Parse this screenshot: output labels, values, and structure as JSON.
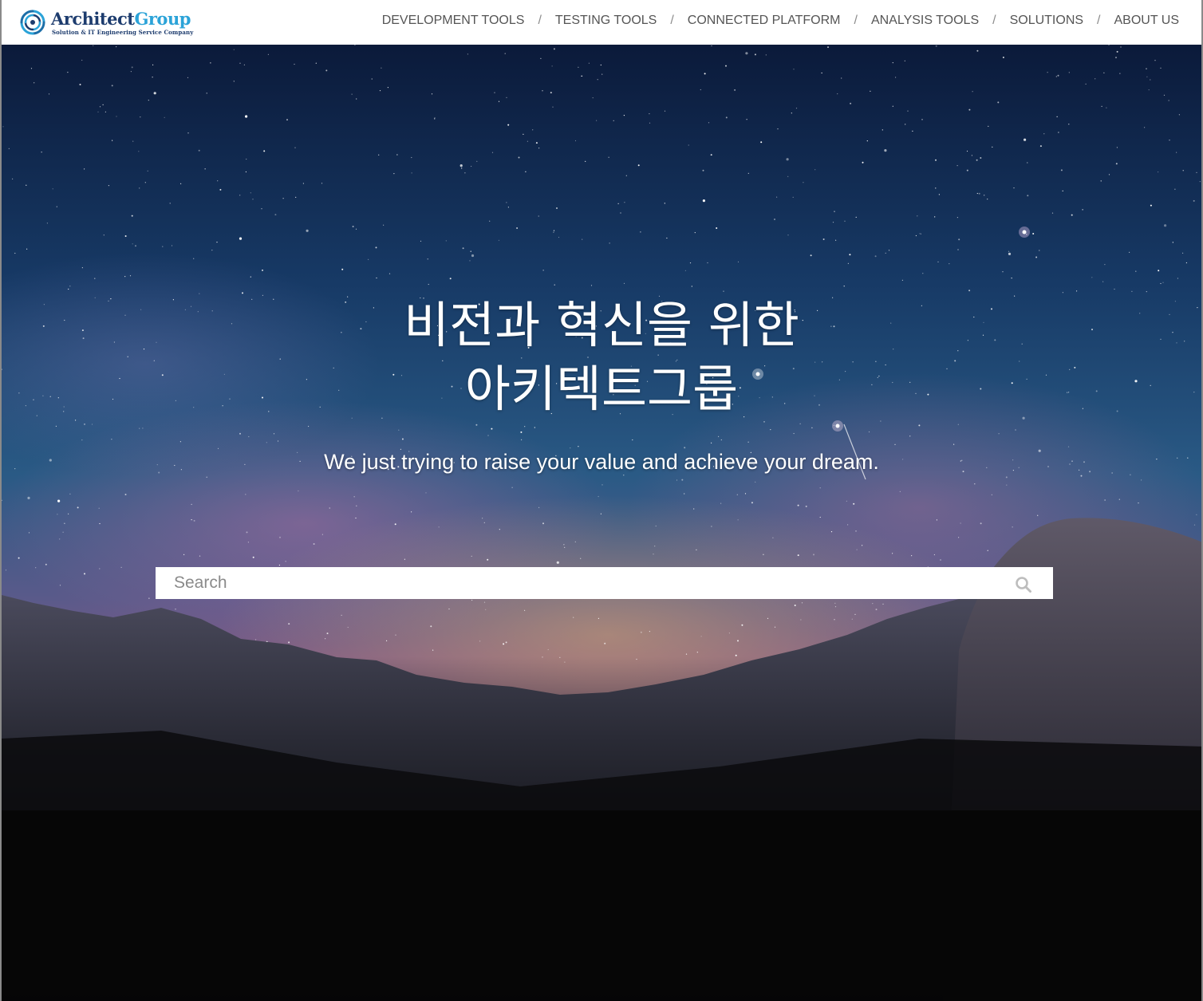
{
  "header": {
    "logo": {
      "name_part1": "Architect",
      "name_part2": "Group",
      "tagline": "Solution & IT Engineering Service Company",
      "icon": "swirl-logo-icon",
      "colors": {
        "dark": "#1d3c6e",
        "light": "#2ba3d8"
      }
    },
    "nav": {
      "separator": "/",
      "items": [
        {
          "label": "DEVELOPMENT TOOLS"
        },
        {
          "label": "TESTING TOOLS"
        },
        {
          "label": "CONNECTED PLATFORM"
        },
        {
          "label": "ANALYSIS TOOLS"
        },
        {
          "label": "SOLUTIONS"
        },
        {
          "label": "ABOUT US"
        }
      ]
    }
  },
  "hero": {
    "title_line1": "비전과 혁신을 위한",
    "title_line2": "아키텍트그룹",
    "subtitle": "We just trying to raise your value and achieve your dream.",
    "background": "starry-night-sky-over-mountains",
    "search": {
      "placeholder": "Search",
      "value": "",
      "icon": "search-icon"
    }
  }
}
